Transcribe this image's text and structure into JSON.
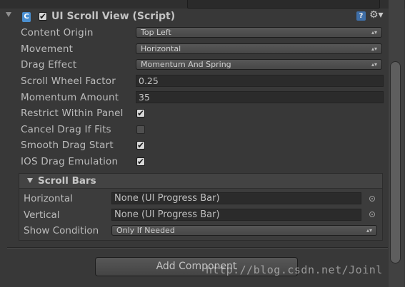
{
  "component": {
    "title": "UI Scroll View (Script)",
    "enabled": true,
    "script_icon_glyph": "C",
    "help_icon_glyph": "?",
    "gear_icon_glyph": "⚙▾"
  },
  "fields": {
    "content_origin": {
      "label": "Content Origin",
      "value": "Top Left"
    },
    "movement": {
      "label": "Movement",
      "value": "Horizontal"
    },
    "drag_effect": {
      "label": "Drag Effect",
      "value": "Momentum And Spring"
    },
    "scroll_wheel_factor": {
      "label": "Scroll Wheel Factor",
      "value": "0.25"
    },
    "momentum_amount": {
      "label": "Momentum Amount",
      "value": "35"
    },
    "restrict_within_panel": {
      "label": "Restrict Within Panel",
      "checked": true
    },
    "cancel_drag_if_fits": {
      "label": "Cancel Drag If Fits",
      "checked": false
    },
    "smooth_drag_start": {
      "label": "Smooth Drag Start",
      "checked": true
    },
    "ios_drag_emulation": {
      "label": "IOS Drag Emulation",
      "checked": true
    }
  },
  "scroll_bars": {
    "title": "Scroll Bars",
    "horizontal": {
      "label": "Horizontal",
      "value": "None (UI Progress Bar)"
    },
    "vertical": {
      "label": "Vertical",
      "value": "None (UI Progress Bar)"
    },
    "show_condition": {
      "label": "Show Condition",
      "value": "Only If Needed"
    }
  },
  "add_component_label": "Add Component",
  "watermark": "http://blog.csdn.net/Joinl",
  "dropdown_arrows": "▴▾",
  "check_glyph": "✔"
}
